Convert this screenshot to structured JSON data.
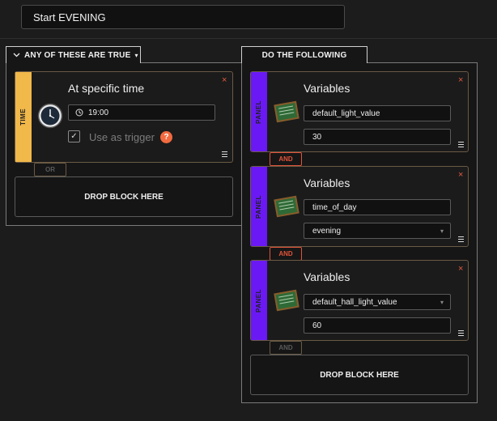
{
  "rule": {
    "name": "Start EVENING"
  },
  "conditions": {
    "header": "ANY OF THESE ARE TRUE",
    "time_block": {
      "side_label": "TIME",
      "title": "At specific time",
      "time_value": "19:00",
      "trigger_label": "Use as trigger",
      "trigger_checked": true,
      "help_glyph": "?"
    },
    "connector": "OR",
    "drop_label": "DROP BLOCK HERE"
  },
  "actions": {
    "header": "DO THE FOLLOWING",
    "blocks": [
      {
        "side_label": "PANEL",
        "title": "Variables",
        "variable": "default_light_value",
        "value": "30"
      },
      {
        "side_label": "PANEL",
        "title": "Variables",
        "variable": "time_of_day",
        "value": "evening"
      },
      {
        "side_label": "PANEL",
        "title": "Variables",
        "variable": "default_hall_light_value",
        "value": "60"
      }
    ],
    "connectors": [
      "AND",
      "AND",
      "AND"
    ],
    "drop_label": "DROP BLOCK HERE"
  },
  "icons": {
    "close": "×",
    "chevron_down": "▾",
    "check": "✓"
  },
  "colors": {
    "time_strip": "#f1b84a",
    "panel_strip": "#6a19f5",
    "accent_red": "#e0533a",
    "help_badge": "#f26a3f"
  }
}
